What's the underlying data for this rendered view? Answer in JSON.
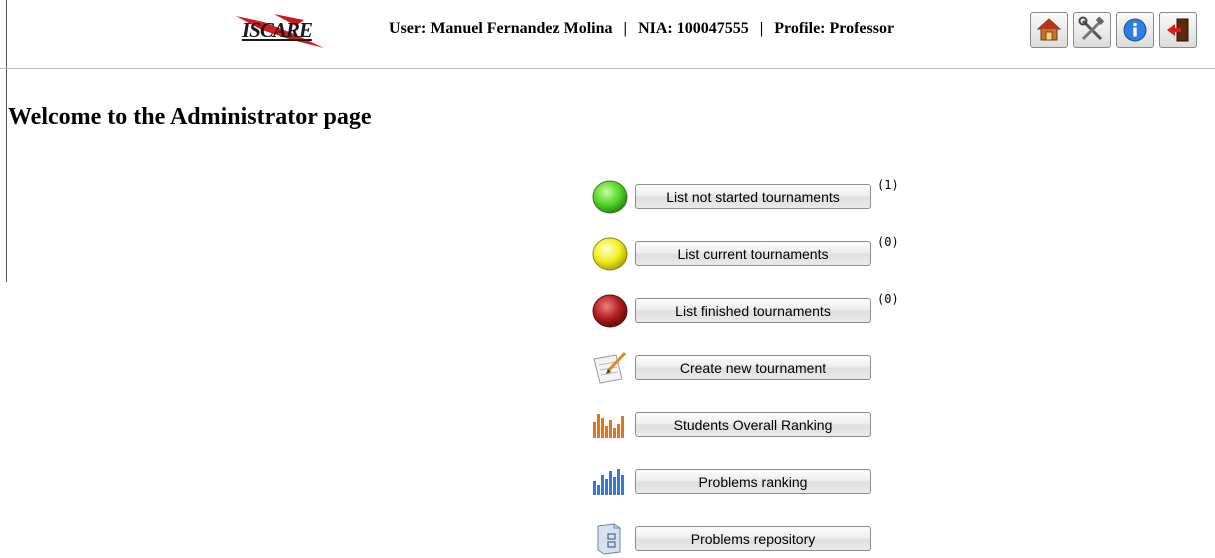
{
  "header": {
    "logo_text": "ISCARE",
    "user_label": "User: Manuel Fernandez Molina",
    "nia_label": "NIA: 100047555",
    "profile_label": "Profile: Professor",
    "separator": "|",
    "toolbar_icons": [
      "home-icon",
      "tools-icon",
      "info-icon",
      "logout-icon"
    ]
  },
  "page": {
    "title": "Welcome to the Administrator page"
  },
  "menu": [
    {
      "label": "List not started tournaments",
      "count": "(1)",
      "icon": "green-light-icon",
      "color": "#3fcf1f"
    },
    {
      "label": "List current tournaments",
      "count": "(0)",
      "icon": "yellow-light-icon",
      "color": "#f2ee1a"
    },
    {
      "label": "List finished tournaments",
      "count": "(0)",
      "icon": "red-light-icon",
      "color": "#a01818"
    },
    {
      "label": "Create new tournament",
      "icon": "edit-notepad-icon"
    },
    {
      "label": "Students Overall Ranking",
      "icon": "orange-bar-chart-icon",
      "color": "#e0761a"
    },
    {
      "label": "Problems ranking",
      "icon": "blue-bar-chart-icon",
      "color": "#3a78d8"
    },
    {
      "label": "Problems repository",
      "icon": "repository-icon"
    }
  ]
}
